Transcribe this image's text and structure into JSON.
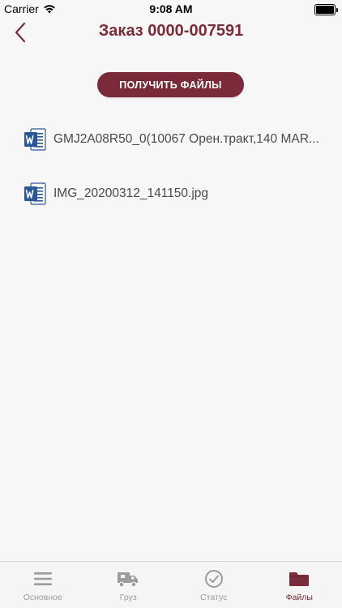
{
  "status_bar": {
    "carrier": "Carrier",
    "time": "9:08 AM"
  },
  "header": {
    "back_icon": "chevron-left-icon",
    "title": "Заказ 0000-007591"
  },
  "actions": {
    "get_files_label": "ПОЛУЧИТЬ ФАЙЛЫ"
  },
  "files": [
    {
      "icon": "word-document-icon",
      "name": "GMJ2A08R50_0(10067 Орен.тракт,140 MAR..."
    },
    {
      "icon": "word-document-icon",
      "name": "IMG_20200312_141150.jpg"
    }
  ],
  "tabbar": {
    "tabs": [
      {
        "label": "Основное",
        "icon": "menu-lines-icon"
      },
      {
        "label": "Груз",
        "icon": "truck-icon"
      },
      {
        "label": "Статус",
        "icon": "check-circle-icon"
      },
      {
        "label": "Файлы",
        "icon": "folder-icon",
        "active": true
      }
    ]
  },
  "colors": {
    "accent": "#7b2c3a",
    "inactive": "#9c9c9c",
    "word_blue": "#2b5797"
  }
}
